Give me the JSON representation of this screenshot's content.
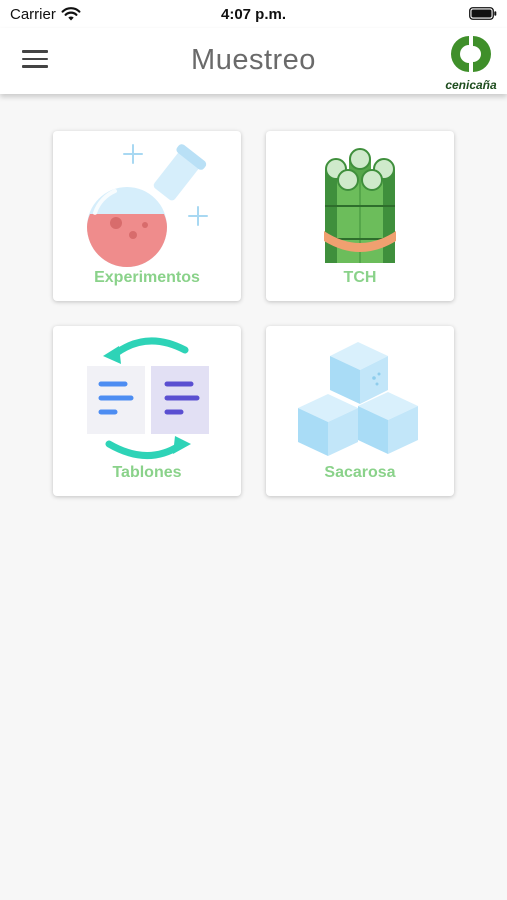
{
  "status_bar": {
    "carrier": "Carrier",
    "time": "4:07 p.m."
  },
  "app_bar": {
    "title": "Muestreo",
    "logo_text": "cenicaña"
  },
  "cards": [
    {
      "label": "Experimentos",
      "icon": "flask-icon"
    },
    {
      "label": "TCH",
      "icon": "sugarcane-icon"
    },
    {
      "label": "Tablones",
      "icon": "sync-documents-icon"
    },
    {
      "label": "Sacarosa",
      "icon": "sugar-cubes-icon"
    }
  ],
  "colors": {
    "label_green": "#8ad28a",
    "logo_green": "#3f8f2a",
    "background": "#f7f7f7"
  }
}
